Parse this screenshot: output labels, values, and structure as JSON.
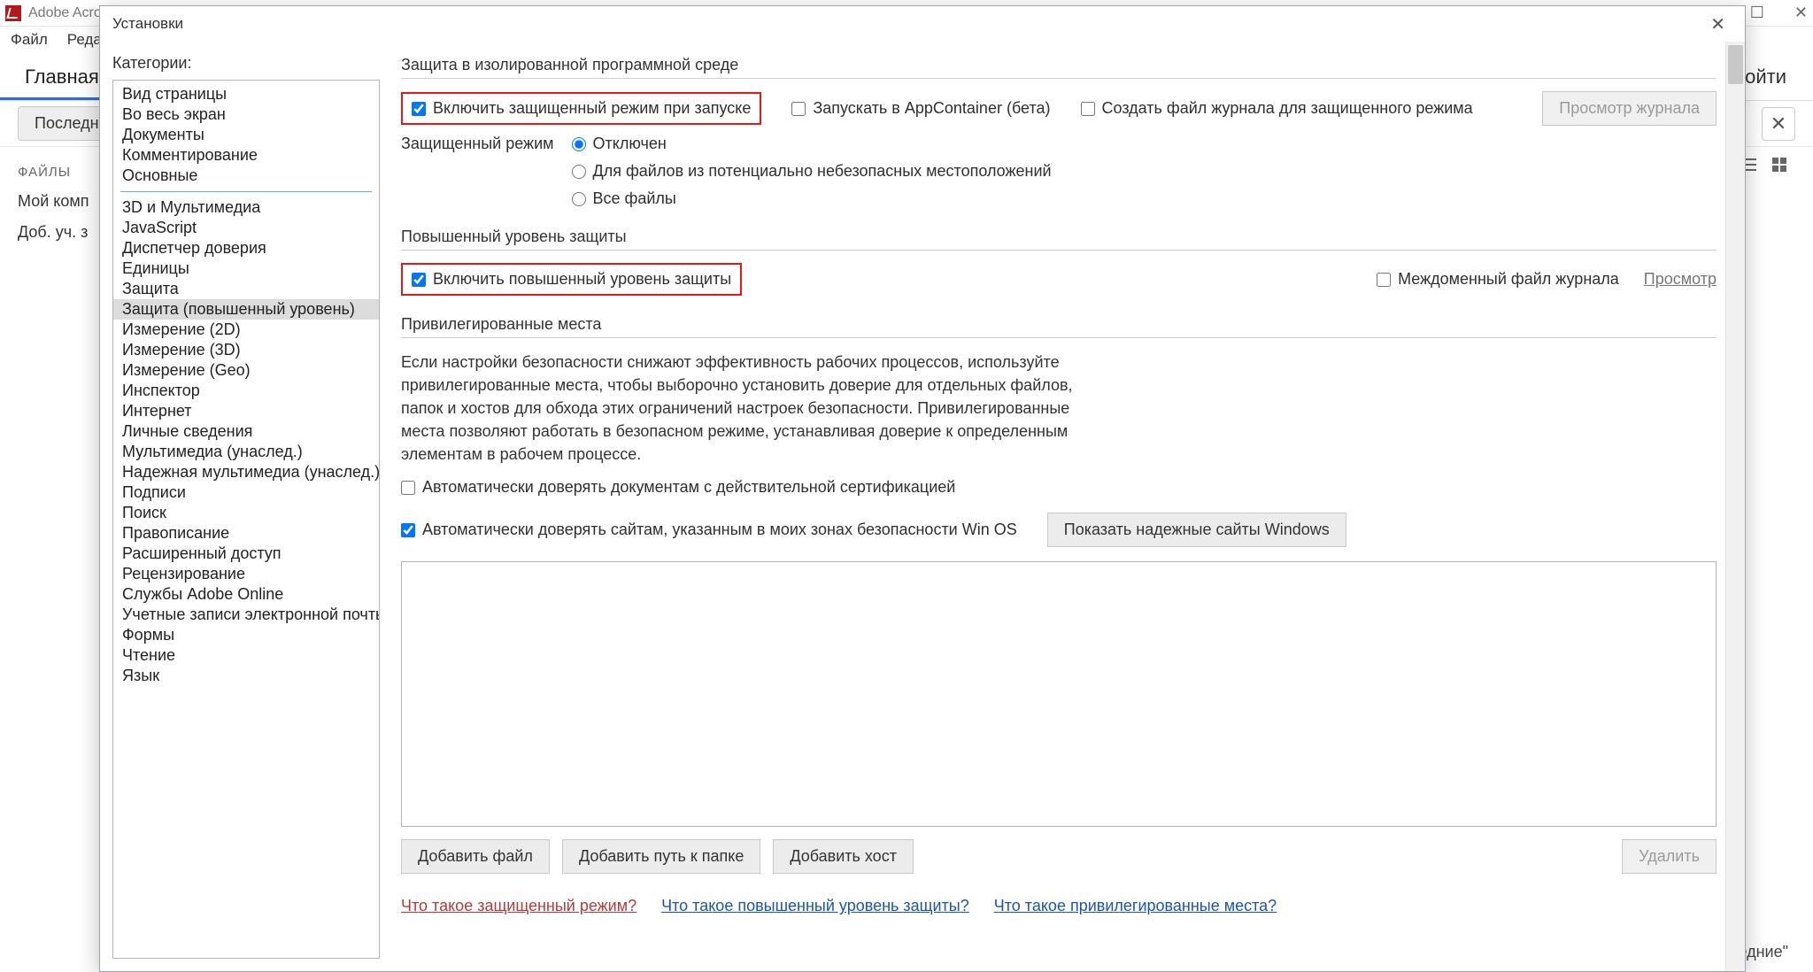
{
  "host": {
    "app_title": "Adobe Acro",
    "menu": {
      "file": "Файл",
      "edit": "Редакти"
    },
    "tab_main": "Главная",
    "login": "Войти",
    "recent_btn": "Последни",
    "side_hdr": "ФАЙЛЫ",
    "side_item1": "Мой комп",
    "side_item2": "Доб. уч. з",
    "footer_hint": "ледние\"",
    "win_min": "—",
    "win_max": "☐",
    "win_close": "✕"
  },
  "dialog": {
    "title": "Установки",
    "close_glyph": "✕",
    "categories_label": "Категории:",
    "categories_group1": [
      "Вид страницы",
      "Во весь экран",
      "Документы",
      "Комментирование",
      "Основные"
    ],
    "categories_group2": [
      "3D и Мультимедиа",
      "JavaScript",
      "Диспетчер доверия",
      "Единицы",
      "Защита",
      "Защита (повышенный уровень)",
      "Измерение (2D)",
      "Измерение (3D)",
      "Измерение (Geo)",
      "Инспектор",
      "Интернет",
      "Личные сведения",
      "Мультимедиа (унаслед.)",
      "Надежная мультимедиа (унаслед.)",
      "Подписи",
      "Поиск",
      "Правописание",
      "Расширенный доступ",
      "Рецензирование",
      "Службы Adobe Online",
      "Учетные записи электронной почты",
      "Формы",
      "Чтение",
      "Язык"
    ],
    "selected_category": "Защита (повышенный уровень)",
    "section1_title": "Защита в изолированной программной среде",
    "chk_protected_launch": "Включить защищенный режим при запуске",
    "chk_appcontainer": "Запускать в AppContainer (бета)",
    "chk_create_log": "Создать файл журнала для защищенного режима",
    "btn_view_log": "Просмотр журнала",
    "protected_mode_label": "Защищенный режим",
    "radio_off": "Отключен",
    "radio_unsafe": "Для файлов из потенциально небезопасных местоположений",
    "radio_all": "Все файлы",
    "section2_title": "Повышенный уровень защиты",
    "chk_enhanced": "Включить повышенный уровень защиты",
    "chk_crossdomain": "Междоменный файл журнала",
    "link_view": "Просмотр",
    "section3_title": "Привилегированные места",
    "priv_desc": "Если настройки безопасности снижают эффективность рабочих процессов, используйте привилегированные места, чтобы выборочно установить доверие для отдельных файлов, папок и хостов для обхода этих ограничений настроек безопасности. Привилегированные места позволяют работать в безопасном режиме, устанавливая доверие к определенным элементам в рабочем процессе.",
    "chk_trust_cert": "Автоматически доверять документам с действительной сертификацией",
    "chk_trust_oszones": "Автоматически доверять сайтам, указанным в моих зонах безопасности Win OS",
    "btn_show_trusted": "Показать надежные сайты Windows",
    "btn_add_file": "Добавить файл",
    "btn_add_folder": "Добавить путь к папке",
    "btn_add_host": "Добавить хост",
    "btn_delete": "Удалить",
    "footer_link1": "Что такое защищенный режим?",
    "footer_link2": "Что такое повышенный уровень защиты?",
    "footer_link3": "Что такое привилегированные места?"
  }
}
